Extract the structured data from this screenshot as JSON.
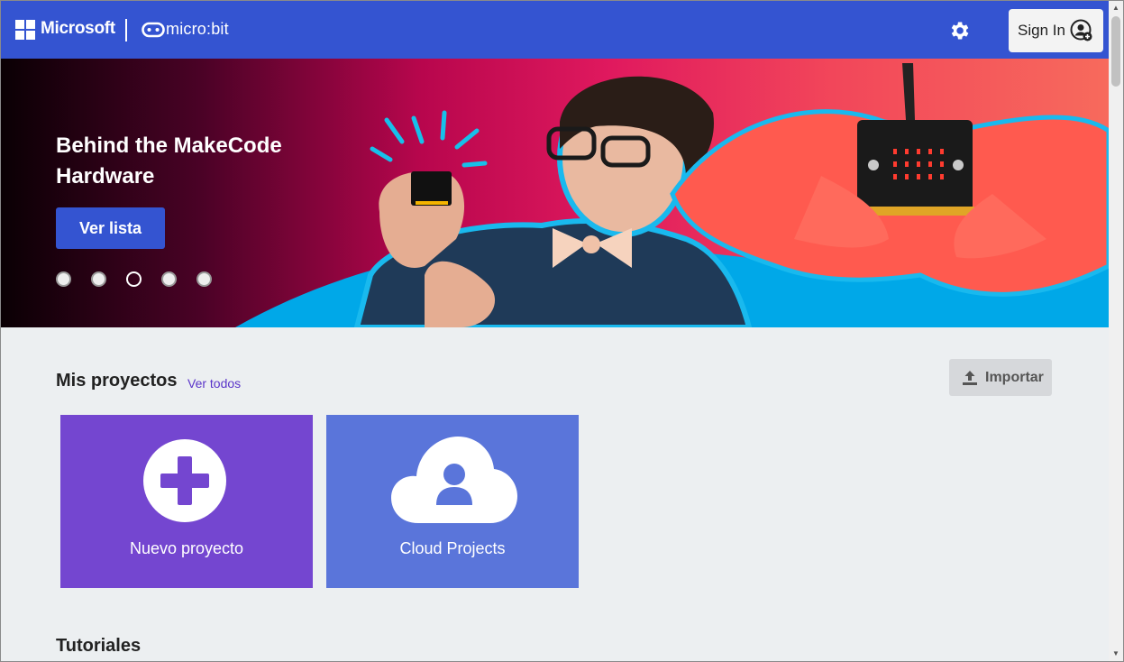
{
  "header": {
    "brand": "Microsoft",
    "product": "micro:bit",
    "signin_label": "Sign In",
    "icons": [
      "windows-logo-icon",
      "microbit-logo-icon",
      "gear-icon",
      "user-avatar-icon"
    ]
  },
  "hero": {
    "title": "Behind the MakeCode Hardware",
    "button_label": "Ver lista",
    "slides": 5,
    "active_slide": 3
  },
  "projects": {
    "heading": "Mis proyectos",
    "view_all": "Ver todos",
    "import_label": "Importar",
    "cards": [
      {
        "label": "Nuevo proyecto",
        "icon": "plus-icon",
        "color": "#7446d0"
      },
      {
        "label": "Cloud Projects",
        "icon": "cloud-user-icon",
        "color": "#5a75da"
      }
    ]
  },
  "tutorials": {
    "heading": "Tutoriales"
  },
  "colors": {
    "header": "#3454d1",
    "accent_link": "#5a35c9",
    "page_bg": "#eceff1"
  }
}
